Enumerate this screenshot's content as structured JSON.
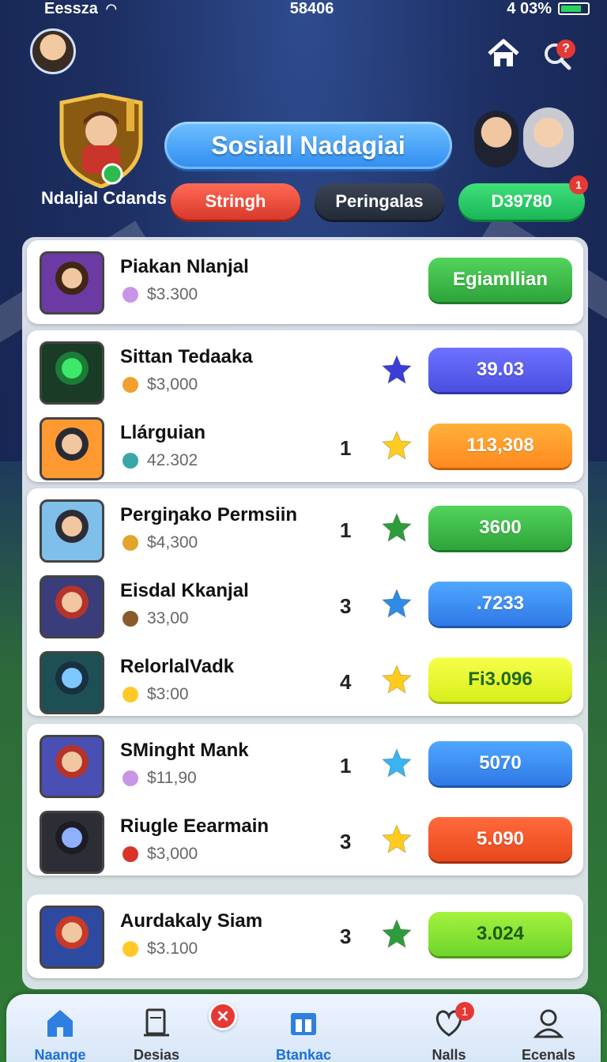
{
  "status_bar": {
    "carrier": "Eessza",
    "time": "58406",
    "battery": "4 03%"
  },
  "header": {
    "search_badge": "?"
  },
  "hero": {
    "title": "Sosiall Nadagiai",
    "player_name": "Ndaljal Cdands",
    "chips": {
      "red": "Stringh",
      "dark": "Peringalas",
      "green": "D39780",
      "green_badge": "1"
    }
  },
  "groups": [
    {
      "rows": [
        {
          "name": "Piakan Nlanjal",
          "sub": "$3.300",
          "rank": "",
          "action": "Egiamllian",
          "action_style": "a-green",
          "thumb_colors": [
            "#6b3aa3",
            "#f1c7a1",
            "#402615"
          ]
        }
      ]
    },
    {
      "rows": [
        {
          "name": "Sittan Tedaaka",
          "sub": "$3,000",
          "rank": "",
          "action": "39.03",
          "action_style": "a-purple",
          "star_color": "#3b3ed6",
          "thumb_colors": [
            "#1a3b25",
            "#3ee86a",
            "#1c7b38"
          ]
        },
        {
          "name": "Llárguian",
          "sub": "42.302",
          "rank": "1",
          "action": "113,308",
          "action_style": "a-orange",
          "star_color": "#ffcb1f",
          "thumb_colors": [
            "#ff9a32",
            "#f1c7a1",
            "#2a2a35"
          ]
        }
      ]
    },
    {
      "rows": [
        {
          "name": "Pergiŋako Permsiin",
          "sub": "$4,300",
          "rank": "1",
          "action": "3600",
          "action_style": "a-green",
          "star_color": "#2e9c3a",
          "thumb_colors": [
            "#7fc0ea",
            "#f1c7a1",
            "#2c2c36"
          ]
        },
        {
          "name": "Eisdal Kkanjal",
          "sub": "33,00",
          "rank": "3",
          "action": ".7233",
          "action_style": "a-blue",
          "star_color": "#2f8be6",
          "thumb_colors": [
            "#3a3d7a",
            "#f1c7a1",
            "#b5332b"
          ]
        },
        {
          "name": "RelorlalVadk",
          "sub": "$3:00",
          "rank": "4",
          "action": "Fi3.096",
          "action_style": "a-yellow",
          "star_color": "#ffcb1f",
          "thumb_colors": [
            "#1e4f55",
            "#7ec8ff",
            "#183040"
          ]
        }
      ]
    },
    {
      "rows": [
        {
          "name": "SMinght Mank",
          "sub": "$11,90",
          "rank": "1",
          "action": "5070",
          "action_style": "a-blue",
          "star_color": "#3bb3ef",
          "thumb_colors": [
            "#4a4fb3",
            "#f1c7a1",
            "#b5332b"
          ]
        },
        {
          "name": "Riugle Eearmain",
          "sub": "$3,000",
          "rank": "3",
          "action": "5.090",
          "action_style": "a-red",
          "star_color": "#ffcb1f",
          "thumb_colors": [
            "#2d2d35",
            "#8fb0ff",
            "#1c1c22"
          ]
        }
      ]
    },
    {
      "rows": [
        {
          "name": "Aurdakaly Siam",
          "sub": "$3.100",
          "rank": "3",
          "action": "3.024",
          "action_style": "a-lime",
          "star_color": "#2e9c3a",
          "thumb_colors": [
            "#2e4aa0",
            "#f1c7a1",
            "#c73a2a"
          ]
        }
      ]
    }
  ],
  "bottom_nav": [
    {
      "label": "Naange",
      "icon": "home-icon",
      "active": true
    },
    {
      "label": "Desias",
      "icon": "document-icon",
      "active": false
    },
    {
      "label": "Btankac",
      "icon": "store-icon",
      "active": true
    },
    {
      "label": "Nalls",
      "icon": "heart-icon",
      "active": false,
      "badge": "1"
    },
    {
      "label": "Ecenals",
      "icon": "profile-icon",
      "active": false
    }
  ],
  "colors": {
    "accent": "#2f8cf0",
    "badge": "#e53935",
    "bg": "#1d2f63"
  }
}
